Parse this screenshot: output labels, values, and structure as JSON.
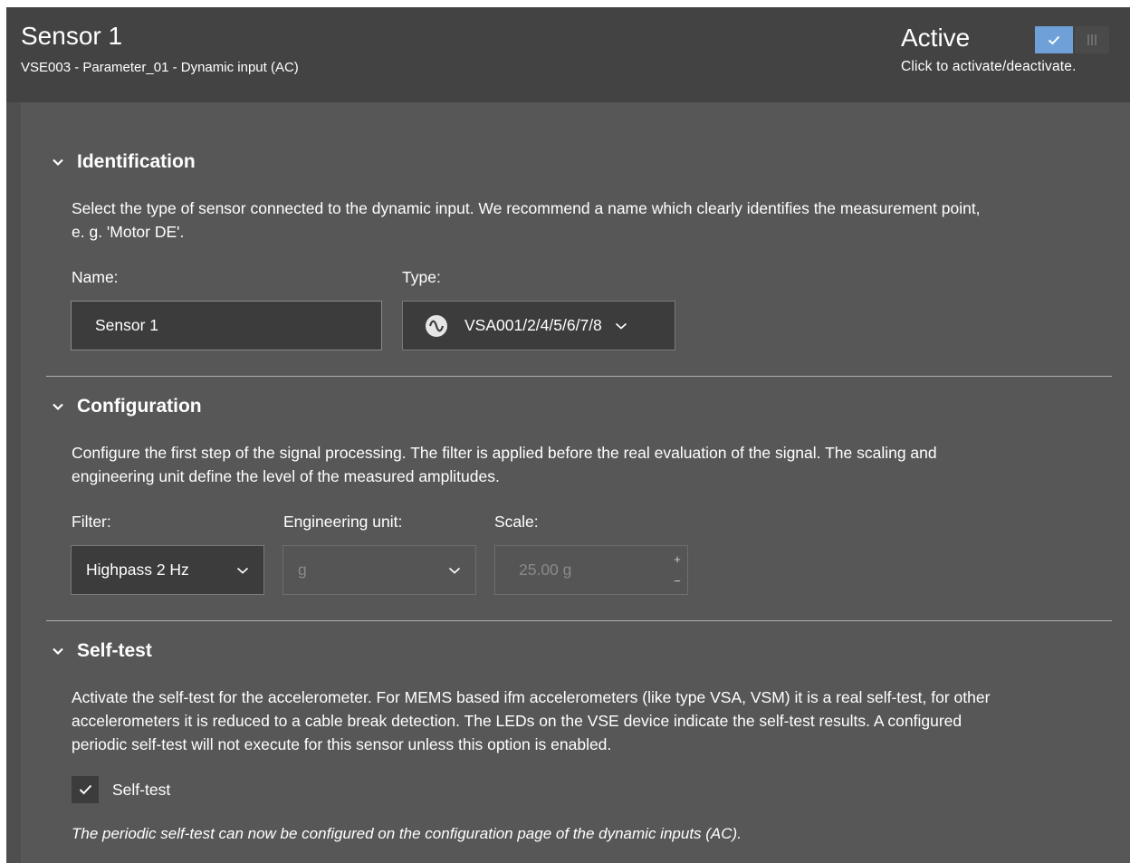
{
  "header": {
    "title": "Sensor 1",
    "subtitle": "VSE003 - Parameter_01 - Dynamic input (AC)",
    "active_label": "Active",
    "active_hint": "Click to activate/deactivate.",
    "toggle_state": "on"
  },
  "identification": {
    "title": "Identification",
    "description_line1": "Select the type of sensor connected to the dynamic input. We recommend a name which clearly identifies the measurement point,",
    "description_line2": "e. g. 'Motor DE'.",
    "name_label": "Name:",
    "name_value": "Sensor 1",
    "type_label": "Type:",
    "type_value": "VSA001/2/4/5/6/7/8",
    "type_icon": "ac-wave-icon"
  },
  "configuration": {
    "title": "Configuration",
    "description_line1": "Configure the first step of the signal processing. The filter is applied before the real evaluation of the signal. The scaling and",
    "description_line2": "engineering unit define the level of the measured amplitudes.",
    "filter_label": "Filter:",
    "filter_value": "Highpass 2 Hz",
    "unit_label": "Engineering unit:",
    "unit_value": "g",
    "scale_label": "Scale:",
    "scale_value": "25.00 g",
    "scale_plus": "+",
    "scale_minus": "−"
  },
  "selftest": {
    "title": "Self-test",
    "description_line1": "Activate the self-test for the accelerometer. For MEMS based ifm accelerometers (like type VSA, VSM) it is a real self-test, for other",
    "description_line2": "accelerometers it is reduced to a cable break detection. The LEDs on the VSE device indicate the self-test results. A configured",
    "description_line3": "periodic self-test will not execute for this sensor unless this option is enabled.",
    "checkbox_label": "Self-test",
    "checked": true,
    "note": "The periodic self-test can now be configured on the configuration page of the dynamic inputs (AC)."
  },
  "colors": {
    "header_bg": "#434343",
    "content_bg": "#575757",
    "accent": "#6fa0d8",
    "input_bg": "#3c3c3c"
  }
}
